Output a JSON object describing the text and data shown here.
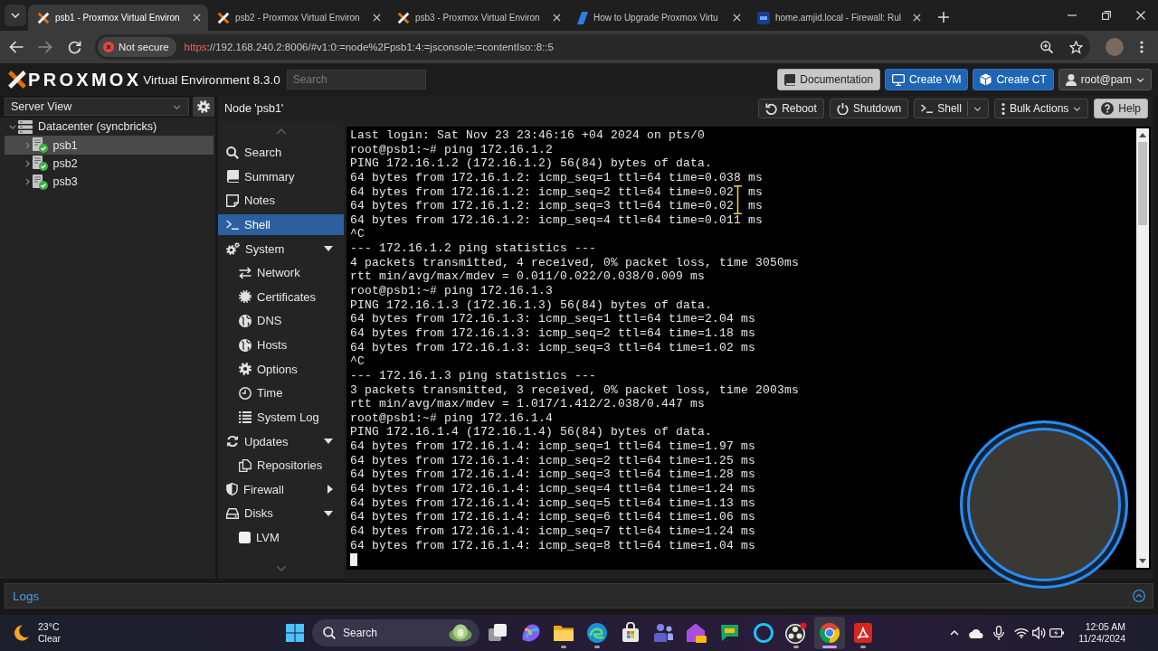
{
  "browser": {
    "tabs": [
      {
        "title": "psb1 - Proxmox Virtual Environ",
        "selected": true
      },
      {
        "title": "psb2 - Proxmox Virtual Environ",
        "selected": false
      },
      {
        "title": "psb3 - Proxmox Virtual Environ",
        "selected": false
      },
      {
        "title": "How to Upgrade Proxmox Virtu",
        "selected": false
      },
      {
        "title": "home.amjid.local - Firewall: Rul",
        "selected": false
      }
    ],
    "security_label": "Not secure",
    "url": {
      "scheme": "https",
      "rest": "://192.168.240.2:8006/#v1:0:=node%2Fpsb1:4:=jsconsole:=contentIso::8::5"
    }
  },
  "app": {
    "brand": "PROXMOX",
    "product": "Virtual Environment 8.3.0",
    "search": {
      "placeholder": "Search"
    },
    "header_buttons": [
      {
        "label": "Documentation",
        "kind": "light"
      },
      {
        "label": "Create VM",
        "kind": "primary"
      },
      {
        "label": "Create CT",
        "kind": "primary"
      },
      {
        "label": "root@pam",
        "kind": "menu"
      }
    ]
  },
  "resource_tree": {
    "view": "Server View",
    "items": [
      {
        "label": "Datacenter (syncbricks)",
        "expanded": true,
        "selected": false,
        "children": [
          {
            "label": "psb1",
            "expanded": false,
            "selected": true
          },
          {
            "label": "psb2",
            "expanded": false,
            "selected": false
          },
          {
            "label": "psb3",
            "expanded": false,
            "selected": false
          }
        ]
      }
    ]
  },
  "content": {
    "title": "Node 'psb1'",
    "toolbar": [
      {
        "label": "Reboot",
        "kind": "plain"
      },
      {
        "label": "Shutdown",
        "kind": "plain"
      },
      {
        "label": "Shell",
        "kind": "split"
      },
      {
        "label": "Bulk Actions",
        "kind": "menu"
      },
      {
        "label": "Help",
        "kind": "light"
      }
    ],
    "nav": [
      {
        "label": "Search",
        "selected": false
      },
      {
        "label": "Summary",
        "selected": false
      },
      {
        "label": "Notes",
        "selected": false
      },
      {
        "label": "Shell",
        "selected": true
      },
      {
        "label": "System",
        "selected": false,
        "expanded": true,
        "children": [
          {
            "label": "Network",
            "selected": false
          },
          {
            "label": "Certificates",
            "selected": false
          },
          {
            "label": "DNS",
            "selected": false
          },
          {
            "label": "Hosts",
            "selected": false
          },
          {
            "label": "Options",
            "selected": false
          },
          {
            "label": "Time",
            "selected": false
          },
          {
            "label": "System Log",
            "selected": false
          }
        ]
      },
      {
        "label": "Updates",
        "selected": false,
        "expanded": true,
        "children": [
          {
            "label": "Repositories",
            "selected": false
          }
        ]
      },
      {
        "label": "Firewall",
        "selected": false,
        "expanded": false
      },
      {
        "label": "Disks",
        "selected": false,
        "expanded": true,
        "children": [
          {
            "label": "LVM",
            "selected": false
          }
        ]
      }
    ],
    "terminal": {
      "lines": [
        "Last login: Sat Nov 23 23:46:16 +04 2024 on pts/0",
        "root@psb1:~# ping 172.16.1.2",
        "PING 172.16.1.2 (172.16.1.2) 56(84) bytes of data.",
        "64 bytes from 172.16.1.2: icmp_seq=1 ttl=64 time=0.038 ms",
        "64 bytes from 172.16.1.2: icmp_seq=2 ttl=64 time=0.02  ms",
        "64 bytes from 172.16.1.2: icmp_seq=3 ttl=64 time=0.02  ms",
        "64 bytes from 172.16.1.2: icmp_seq=4 ttl=64 time=0.011 ms",
        "^C",
        "--- 172.16.1.2 ping statistics ---",
        "4 packets transmitted, 4 received, 0% packet loss, time 3050ms",
        "rtt min/avg/max/mdev = 0.011/0.022/0.038/0.009 ms",
        "root@psb1:~# ping 172.16.1.3",
        "PING 172.16.1.3 (172.16.1.3) 56(84) bytes of data.",
        "64 bytes from 172.16.1.3: icmp_seq=1 ttl=64 time=2.04 ms",
        "64 bytes from 172.16.1.3: icmp_seq=2 ttl=64 time=1.18 ms",
        "64 bytes from 172.16.1.3: icmp_seq=3 ttl=64 time=1.02 ms",
        "^C",
        "--- 172.16.1.3 ping statistics ---",
        "3 packets transmitted, 3 received, 0% packet loss, time 2003ms",
        "rtt min/avg/max/mdev = 1.017/1.412/2.038/0.447 ms",
        "root@psb1:~# ping 172.16.1.4",
        "PING 172.16.1.4 (172.16.1.4) 56(84) bytes of data.",
        "64 bytes from 172.16.1.4: icmp_seq=1 ttl=64 time=1.97 ms",
        "64 bytes from 172.16.1.4: icmp_seq=2 ttl=64 time=1.25 ms",
        "64 bytes from 172.16.1.4: icmp_seq=3 ttl=64 time=1.28 ms",
        "64 bytes from 172.16.1.4: icmp_seq=4 ttl=64 time=1.24 ms",
        "64 bytes from 172.16.1.4: icmp_seq=5 ttl=64 time=1.13 ms",
        "64 bytes from 172.16.1.4: icmp_seq=6 ttl=64 time=1.06 ms",
        "64 bytes from 172.16.1.4: icmp_seq=7 ttl=64 time=1.24 ms",
        "64 bytes from 172.16.1.4: icmp_seq=8 ttl=64 time=1.04 ms"
      ]
    }
  },
  "logs_panel": {
    "title": "Logs"
  },
  "taskbar": {
    "weather": {
      "temperature": "23°C",
      "condition": "Clear"
    },
    "search": {
      "placeholder": "Search"
    },
    "apps": [
      {
        "running": false,
        "selected": false
      },
      {
        "running": false,
        "selected": false
      },
      {
        "running": true,
        "selected": false
      },
      {
        "running": true,
        "selected": false
      },
      {
        "running": false,
        "selected": false
      },
      {
        "running": false,
        "selected": false
      },
      {
        "running": false,
        "selected": false
      },
      {
        "running": false,
        "selected": false
      },
      {
        "running": false,
        "selected": false
      },
      {
        "running": true,
        "selected": false
      },
      {
        "running": true,
        "selected": true
      },
      {
        "running": true,
        "selected": false
      }
    ],
    "clock": {
      "time": "12:05 AM",
      "date": "11/24/2024"
    }
  }
}
